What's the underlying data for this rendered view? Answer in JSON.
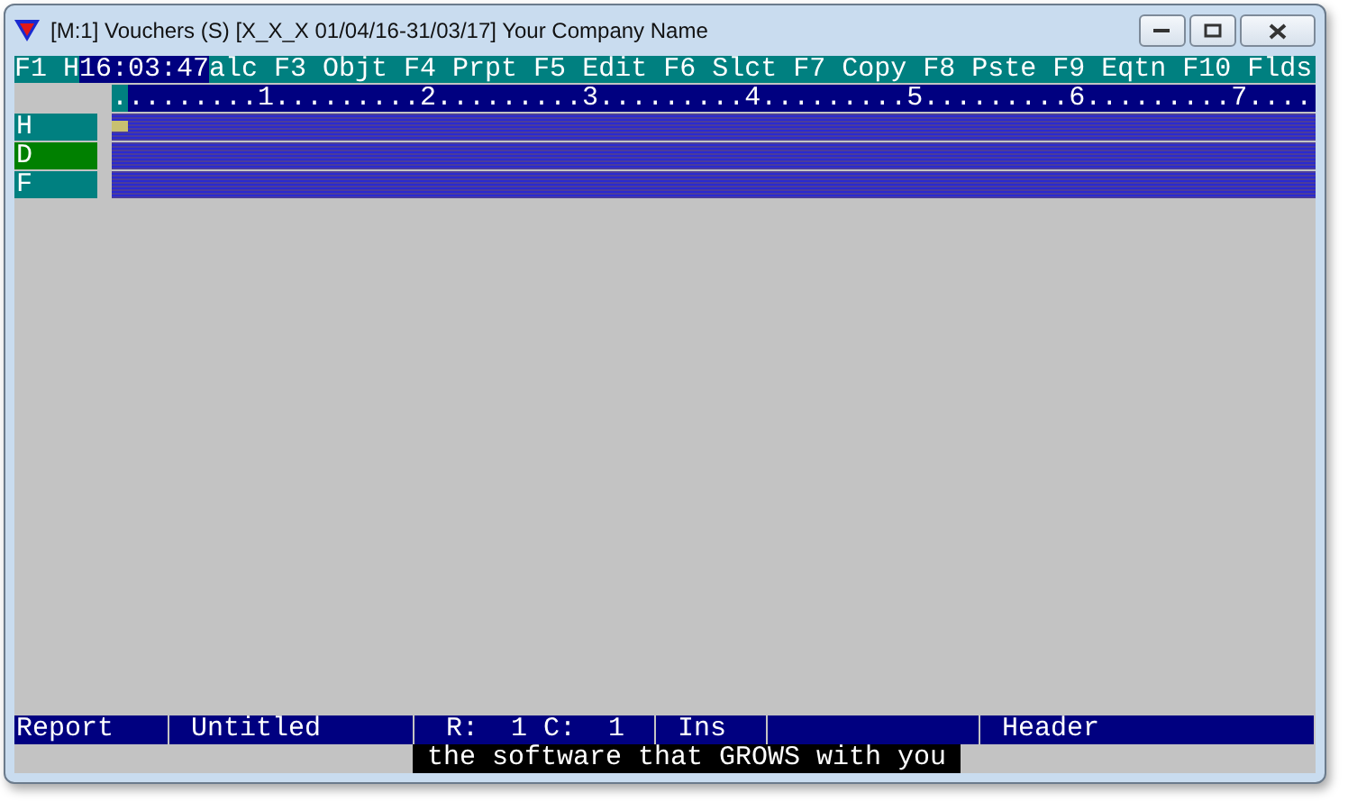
{
  "window": {
    "title": "[M:1]  Vouchers (S)  [X_X_X  01/04/16-31/03/17]  Your Company Name"
  },
  "function_bar": {
    "before_clock": "F1 H",
    "clock": "16:03:47",
    "after_clock": "alc F3 Objt F4 Prpt F5 Edit F6 Slct F7 Copy F8 Pste F9 Eqtn F10 Flds"
  },
  "ruler": {
    "cursor": ".",
    "text": "........1.........2.........3.........4.........5.........6.........7...."
  },
  "bands": [
    {
      "label": "H",
      "selected": false
    },
    {
      "label": "D",
      "selected": true
    },
    {
      "label": "F",
      "selected": false
    }
  ],
  "status_bar": [
    "Report",
    "Untitled",
    "R:  1 C:  1",
    "Ins",
    "Header"
  ],
  "tagline": "the software that GROWS with you"
}
